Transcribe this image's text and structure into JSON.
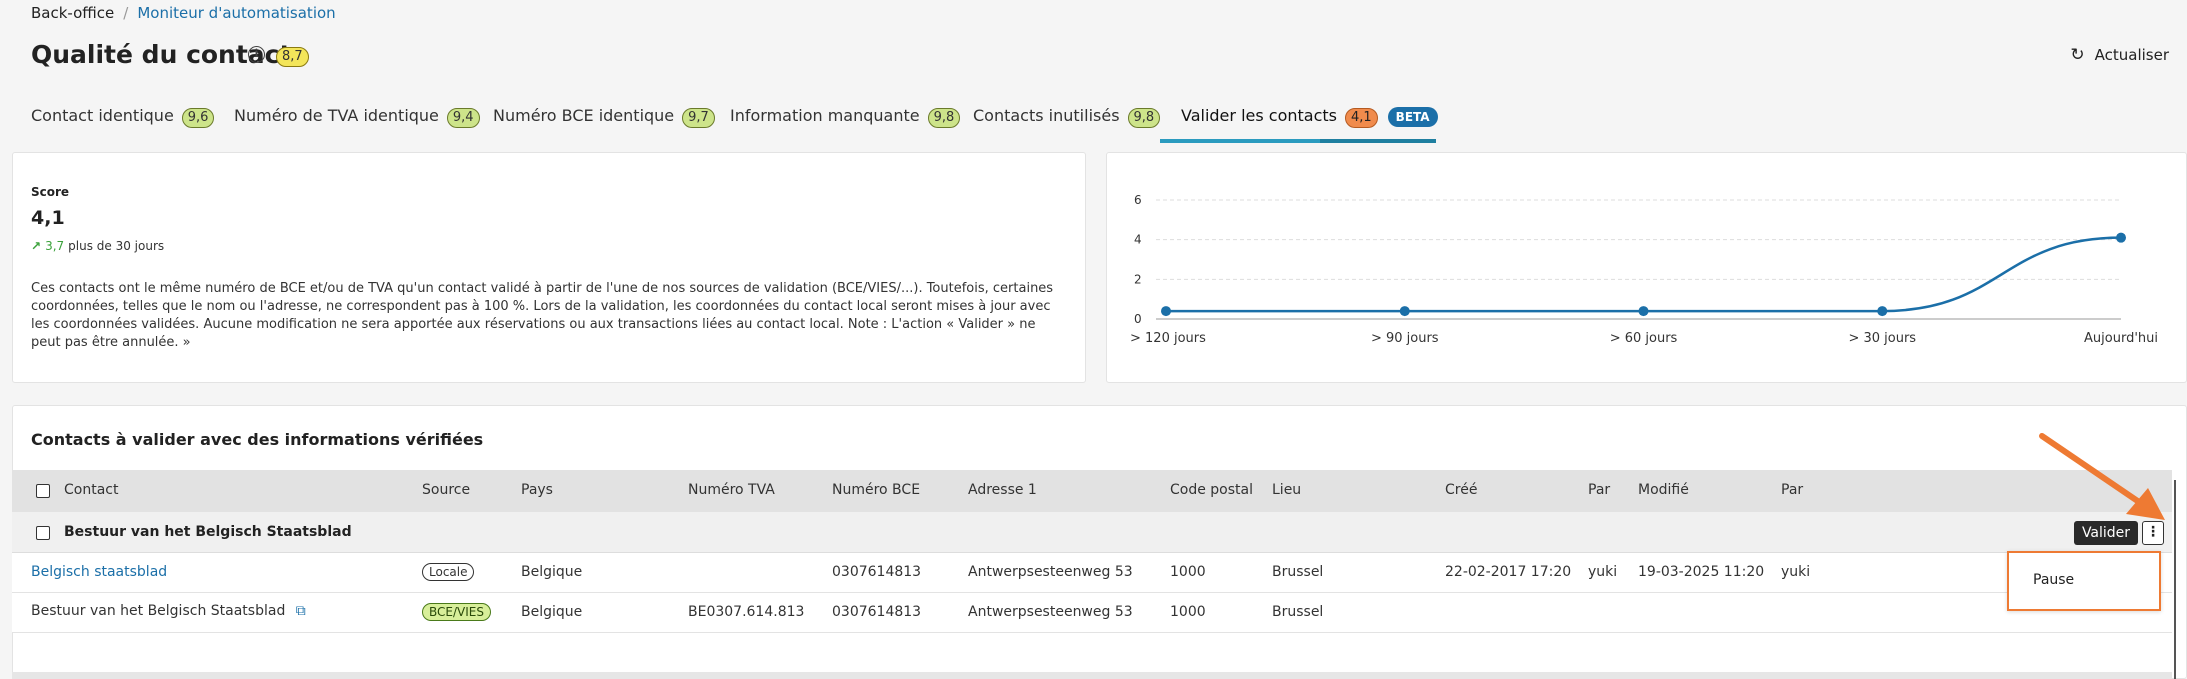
{
  "breadcrumb": {
    "root": "Back-office",
    "separator": "/",
    "current": "Moniteur d'automatisation"
  },
  "page": {
    "title": "Qualité du contact",
    "score_badge": "8,7",
    "refresh_label": "Actualiser"
  },
  "tabs": [
    {
      "label": "Contact identique",
      "badge": "9,6"
    },
    {
      "label": "Numéro de TVA identique",
      "badge": "9,4"
    },
    {
      "label": "Numéro BCE identique",
      "badge": "9,7"
    },
    {
      "label": "Information manquante",
      "badge": "9,8"
    },
    {
      "label": "Contacts inutilisés",
      "badge": "9,8"
    },
    {
      "label": "Valider les contacts",
      "badge": "4,1",
      "extra": "BETA",
      "active": true
    }
  ],
  "score": {
    "label": "Score",
    "value": "4,1",
    "trend_value": "3,7",
    "trend_text": "plus de 30 jours",
    "description": "Ces contacts ont le même numéro de BCE et/ou de TVA qu'un contact validé à partir de l'une de nos sources de validation (BCE/VIES/...). Toutefois, certaines coordonnées, telles que le nom ou l'adresse, ne correspondent pas à 100 %. Lors de la validation, les coordonnées du contact local seront mises à jour avec les coordonnées validées. Aucune modification ne sera apportée aux réservations ou aux transactions liées au contact local. Note : L'action « Valider » ne peut pas être annulée. »"
  },
  "chart_data": {
    "type": "line",
    "categories": [
      "> 120 jours",
      "> 90 jours",
      "> 60 jours",
      "> 30 jours",
      "Aujourd'hui"
    ],
    "values": [
      0.4,
      0.4,
      0.4,
      0.4,
      4.1
    ],
    "yticks": [
      "0",
      "2",
      "4",
      "6"
    ],
    "ylim": [
      0,
      6
    ],
    "grid": true,
    "color": "#1b6fa8"
  },
  "table": {
    "title": "Contacts à valider avec des informations vérifiées",
    "columns": [
      "Contact",
      "Source",
      "Pays",
      "Numéro TVA",
      "Numéro BCE",
      "Adresse 1",
      "Code postal",
      "Lieu",
      "Créé",
      "Par",
      "Modifié",
      "Par"
    ],
    "group": {
      "label": "Bestuur van het Belgisch Staatsblad",
      "validate_label": "Valider",
      "more_label": "⋮",
      "menu_item": "Pause"
    },
    "rows": [
      {
        "contact": "Belgisch staatsblad",
        "source": "Locale",
        "pays": "Belgique",
        "tva": "",
        "bce": "0307614813",
        "adresse": "Antwerpsesteenweg 53",
        "cp": "1000",
        "lieu": "Brussel",
        "cree": "22-02-2017 17:20",
        "par1": "yuki",
        "modifie": "19-03-2025 11:20",
        "par2": "yuki"
      },
      {
        "contact": "Bestuur van het Belgisch Staatsblad",
        "source": "BCE/VIES",
        "pays": "Belgique",
        "tva": "BE0307.614.813",
        "bce": "0307614813",
        "adresse": "Antwerpsesteenweg 53",
        "cp": "1000",
        "lieu": "Brussel",
        "cree": "",
        "par1": "",
        "modifie": "",
        "par2": ""
      }
    ]
  },
  "colors": {
    "accent": "#1b6fa8",
    "tab_underline": "#1f7fa0",
    "highlight": "#ee7a33"
  }
}
